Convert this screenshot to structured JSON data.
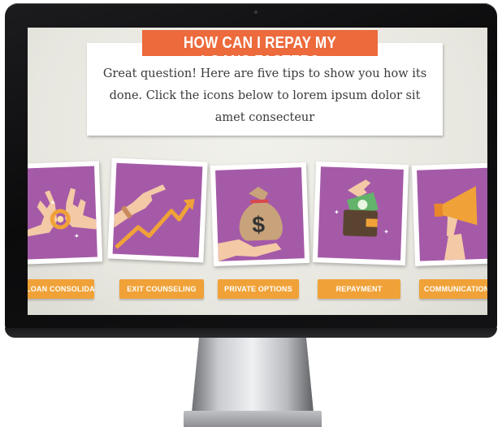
{
  "heading": {
    "title": "HOW CAN I REPAY MY LOANS FASTER?"
  },
  "intro": {
    "text": "Great question! Here are five tips to show you how its done. Click the icons below to lorem ipsum dolor sit amet consecteur"
  },
  "tips": [
    {
      "label": "LOAN CONSOLIDATION",
      "icon": "hands-ring-icon"
    },
    {
      "label": "EXIT COUNSELING",
      "icon": "pointing-hand-arrow-icon"
    },
    {
      "label": "PRIVATE OPTIONS",
      "icon": "money-bag-icon"
    },
    {
      "label": "REPAYMENT",
      "icon": "wallet-cash-icon"
    },
    {
      "label": "COMMUNICATION",
      "icon": "megaphone-icon"
    }
  ],
  "colors": {
    "accent": "#ec6a3c",
    "button": "#f0a238",
    "tile": "#a55aa8"
  }
}
